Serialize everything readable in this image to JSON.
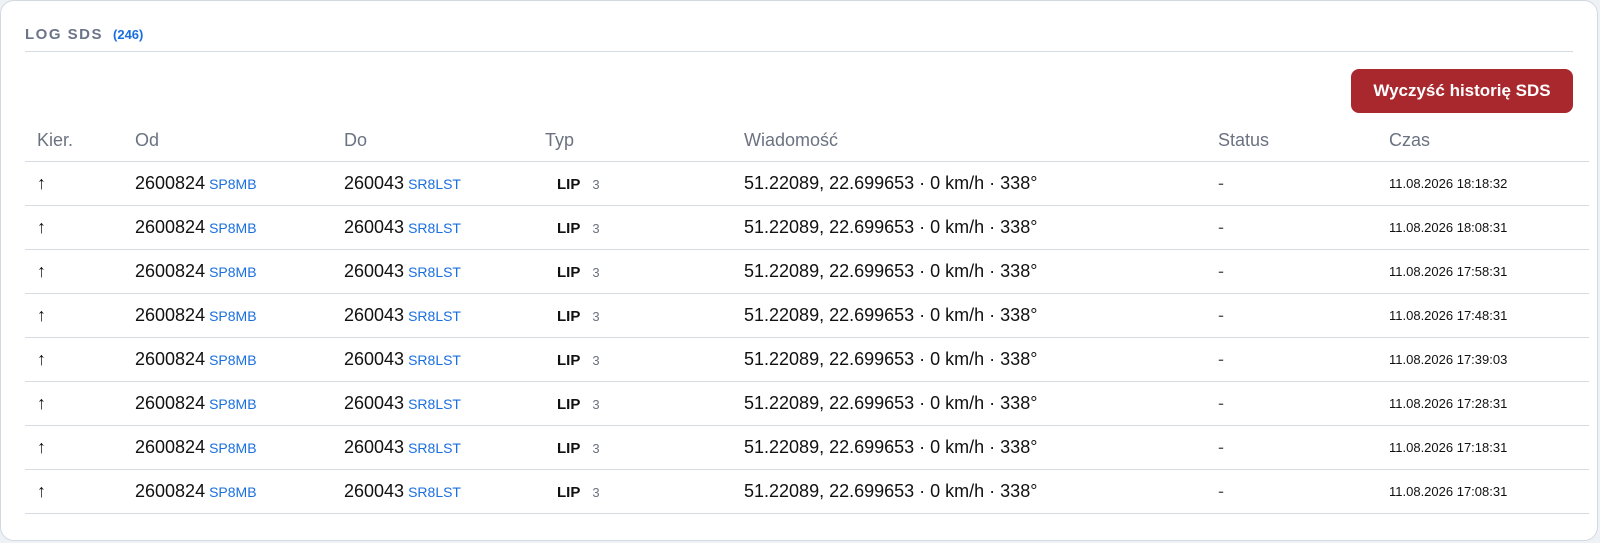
{
  "header": {
    "title": "LOG SDS",
    "count": "(246)"
  },
  "toolbar": {
    "clear_label": "Wyczyść historię SDS"
  },
  "columns": [
    "Kier.",
    "Od",
    "Do",
    "Typ",
    "Wiadomość",
    "Status",
    "Czas"
  ],
  "rows": [
    {
      "dir": "↑",
      "from_id": "2600824",
      "from_call": "SP8MB",
      "to_id": "260043",
      "to_call": "SR8LST",
      "type": "LIP",
      "type_num": "3",
      "message": "51.22089, 22.699653 · 0 km/h · 338°",
      "status": "-",
      "time": "11.08.2026 18:18:32"
    },
    {
      "dir": "↑",
      "from_id": "2600824",
      "from_call": "SP8MB",
      "to_id": "260043",
      "to_call": "SR8LST",
      "type": "LIP",
      "type_num": "3",
      "message": "51.22089, 22.699653 · 0 km/h · 338°",
      "status": "-",
      "time": "11.08.2026 18:08:31"
    },
    {
      "dir": "↑",
      "from_id": "2600824",
      "from_call": "SP8MB",
      "to_id": "260043",
      "to_call": "SR8LST",
      "type": "LIP",
      "type_num": "3",
      "message": "51.22089, 22.699653 · 0 km/h · 338°",
      "status": "-",
      "time": "11.08.2026 17:58:31"
    },
    {
      "dir": "↑",
      "from_id": "2600824",
      "from_call": "SP8MB",
      "to_id": "260043",
      "to_call": "SR8LST",
      "type": "LIP",
      "type_num": "3",
      "message": "51.22089, 22.699653 · 0 km/h · 338°",
      "status": "-",
      "time": "11.08.2026 17:48:31"
    },
    {
      "dir": "↑",
      "from_id": "2600824",
      "from_call": "SP8MB",
      "to_id": "260043",
      "to_call": "SR8LST",
      "type": "LIP",
      "type_num": "3",
      "message": "51.22089, 22.699653 · 0 km/h · 338°",
      "status": "-",
      "time": "11.08.2026 17:39:03"
    },
    {
      "dir": "↑",
      "from_id": "2600824",
      "from_call": "SP8MB",
      "to_id": "260043",
      "to_call": "SR8LST",
      "type": "LIP",
      "type_num": "3",
      "message": "51.22089, 22.699653 · 0 km/h · 338°",
      "status": "-",
      "time": "11.08.2026 17:28:31"
    },
    {
      "dir": "↑",
      "from_id": "2600824",
      "from_call": "SP8MB",
      "to_id": "260043",
      "to_call": "SR8LST",
      "type": "LIP",
      "type_num": "3",
      "message": "51.22089, 22.699653 · 0 km/h · 338°",
      "status": "-",
      "time": "11.08.2026 17:18:31"
    },
    {
      "dir": "↑",
      "from_id": "2600824",
      "from_call": "SP8MB",
      "to_id": "260043",
      "to_call": "SR8LST",
      "type": "LIP",
      "type_num": "3",
      "message": "51.22089, 22.699653 · 0 km/h · 338°",
      "status": "-",
      "time": "11.08.2026 17:08:31"
    }
  ]
}
